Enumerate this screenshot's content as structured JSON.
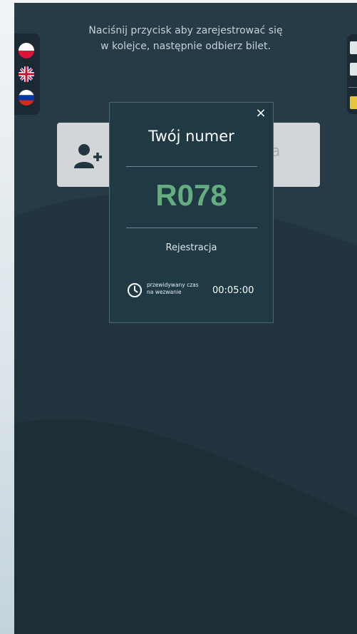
{
  "header": {
    "instruction_line1": "Naciśnij przycisk aby zarejestrować się",
    "instruction_line2": "w kolejce, następnie odbierz bilet."
  },
  "languages": [
    {
      "code": "pl",
      "icon": "poland-flag-icon"
    },
    {
      "code": "en",
      "icon": "uk-flag-icon"
    },
    {
      "code": "ru",
      "icon": "russia-flag-icon"
    }
  ],
  "register_card": {
    "icon": "add-user-icon",
    "label_fragment": "a"
  },
  "modal": {
    "title": "Twój numer",
    "ticket_number": "R078",
    "service": "Rejestracja",
    "eta_label_line1": "przewidywany czas",
    "eta_label_line2": "na wezwanie",
    "eta_time": "00:05:00",
    "close_symbol": "×"
  },
  "colors": {
    "kiosk_background": "#263b46",
    "modal_background": "#1f3a45",
    "ticket_number": "#63ad7f",
    "card_background": "#d2d6d8"
  }
}
